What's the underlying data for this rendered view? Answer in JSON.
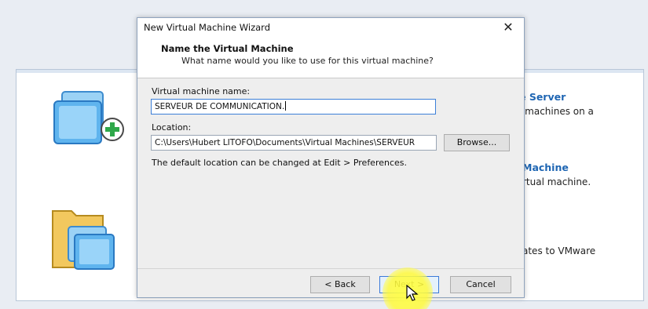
{
  "home": {
    "items": [
      {
        "title_fragment": "e Server",
        "desc_fragment": "l machines on a"
      },
      {
        "title_fragment": "Machine",
        "desc_fragment": "rtual machine."
      },
      {
        "title_fragment": "",
        "desc_fragment": "ates to VMware"
      }
    ]
  },
  "dialog": {
    "title": "New Virtual Machine Wizard",
    "close_label": "✕",
    "header_title": "Name the Virtual Machine",
    "header_subtitle": "What name would you like to use for this virtual machine?",
    "name_label": "Virtual machine name:",
    "name_value": "SERVEUR DE COMMUNICATION.",
    "location_label": "Location:",
    "location_value": "C:\\Users\\Hubert LITOFO\\Documents\\Virtual Machines\\SERVEUR",
    "browse_label": "Browse...",
    "hint": "The default location can be changed at Edit > Preferences.",
    "back_label": "< Back",
    "next_label": "Next >",
    "cancel_label": "Cancel"
  },
  "colors": {
    "accent_link": "#1f66b3",
    "focus_border": "#3c7fd8",
    "click_highlight": "#ffff46"
  }
}
